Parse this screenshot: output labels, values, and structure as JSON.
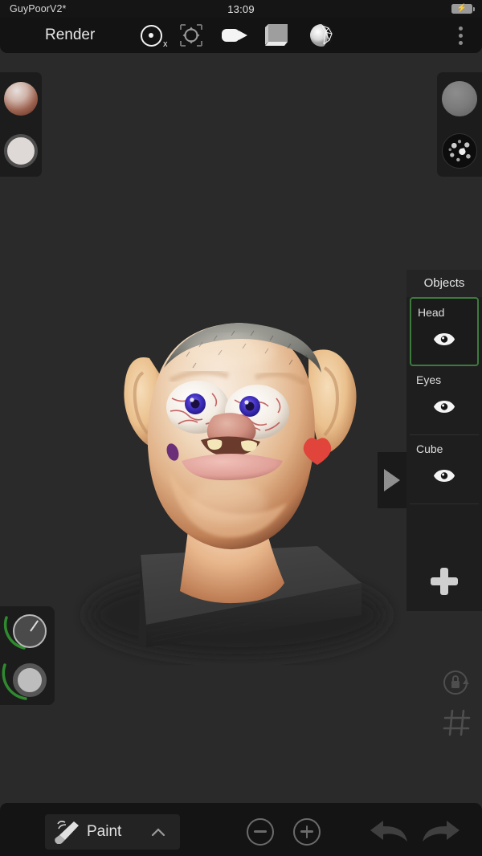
{
  "status_bar": {
    "project_title": "GuyPoorV2*",
    "clock": "13:09",
    "battery_icon": "battery-charging-icon",
    "battery_bolt": "⚡"
  },
  "top_bar": {
    "mode_label": "Render",
    "symmetry_axis": "x",
    "tools": [
      {
        "name": "symmetry-icon",
        "label": "Symmetry X"
      },
      {
        "name": "gizmo-move-icon",
        "label": "Transform Gizmo"
      },
      {
        "name": "camera-icon",
        "label": "Camera"
      },
      {
        "name": "box-environment-icon",
        "label": "Environment Box"
      },
      {
        "name": "topology-sphere-icon",
        "label": "Topology"
      }
    ],
    "overflow_menu": "⋮"
  },
  "material_panel": {
    "material_sphere": "material-preview-sphere",
    "color_swatch": "color-swatch",
    "color_hex": "#ded9d6"
  },
  "environment_panel": {
    "matcap_sphere": "matcap-preview-sphere",
    "hdri_sphere": "hdri-environment-sphere"
  },
  "objects_panel": {
    "title": "Objects",
    "items": [
      {
        "label": "Head",
        "visible": true,
        "selected": true
      },
      {
        "label": "Eyes",
        "visible": true,
        "selected": false
      },
      {
        "label": "Cube",
        "visible": true,
        "selected": false
      }
    ],
    "add_label": "+",
    "selection_color": "#3d7a3d",
    "collapse_toggle": "panel-collapse-arrow"
  },
  "dials": {
    "brush_size": {
      "name": "brush-size-dial",
      "arc_color": "#2f8a2f"
    },
    "brush_intensity": {
      "name": "brush-intensity-dial",
      "arc_color": "#2f8a2f"
    }
  },
  "viewport_tools": {
    "lock_rotation": "lock-rotation-icon",
    "grid": "grid-icon"
  },
  "bottom_bar": {
    "active_tool": "Paint",
    "tool_icon": "paintbrush-icon",
    "expand_chevron": "chevron-up-icon",
    "zoom_out": "minus-circle-icon",
    "zoom_in": "plus-circle-icon",
    "undo": "undo-arrow-icon",
    "redo": "redo-arrow-icon"
  },
  "scene": {
    "model_name": "sculpted head",
    "background_color": "#2a2a2a",
    "platform_color": "#3a3a3a",
    "skin_highlight": "#f2e0cf",
    "skin_mid": "#e8c39b",
    "skin_shadow": "#b9805c",
    "hair_color": "#8a8a86",
    "eye_iris": "#4b3ccb",
    "eye_sclera": "#f4efe9",
    "vein_color": "#b94a4a",
    "heart_mark": "#e04a3c",
    "purple_mark": "#6b2f7a",
    "lip_color": "#e4a49c"
  }
}
